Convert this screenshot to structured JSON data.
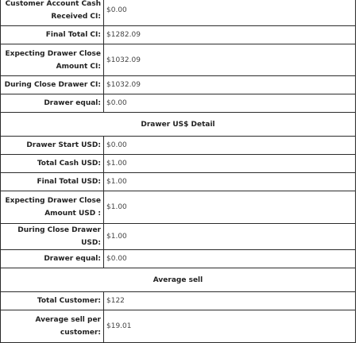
{
  "drawer_ci": {
    "rows": [
      {
        "label": "Customer Account Cash Received CI:",
        "value": "$0.00"
      },
      {
        "label": "Final Total CI:",
        "value": "$1282.09"
      },
      {
        "label": "Expecting Drawer Close Amount CI:",
        "value": "$1032.09"
      },
      {
        "label": "During Close Drawer CI:",
        "value": "$1032.09"
      },
      {
        "label": "Drawer equal:",
        "value": "$0.00"
      }
    ]
  },
  "drawer_usd": {
    "title": "Drawer US$ Detail",
    "rows": [
      {
        "label": "Drawer Start USD:",
        "value": "$0.00"
      },
      {
        "label": "Total Cash USD:",
        "value": "$1.00"
      },
      {
        "label": "Final Total USD:",
        "value": "$1.00"
      },
      {
        "label": "Expecting Drawer Close Amount USD :",
        "value": "$1.00"
      },
      {
        "label": "During Close Drawer USD:",
        "value": "$1.00"
      },
      {
        "label": "Drawer equal:",
        "value": "$0.00"
      }
    ]
  },
  "average_sell": {
    "title": "Average sell",
    "rows": [
      {
        "label": "Total Customer:",
        "value": "$122"
      },
      {
        "label": "Average sell per customer:",
        "value": "$19.01"
      }
    ]
  }
}
